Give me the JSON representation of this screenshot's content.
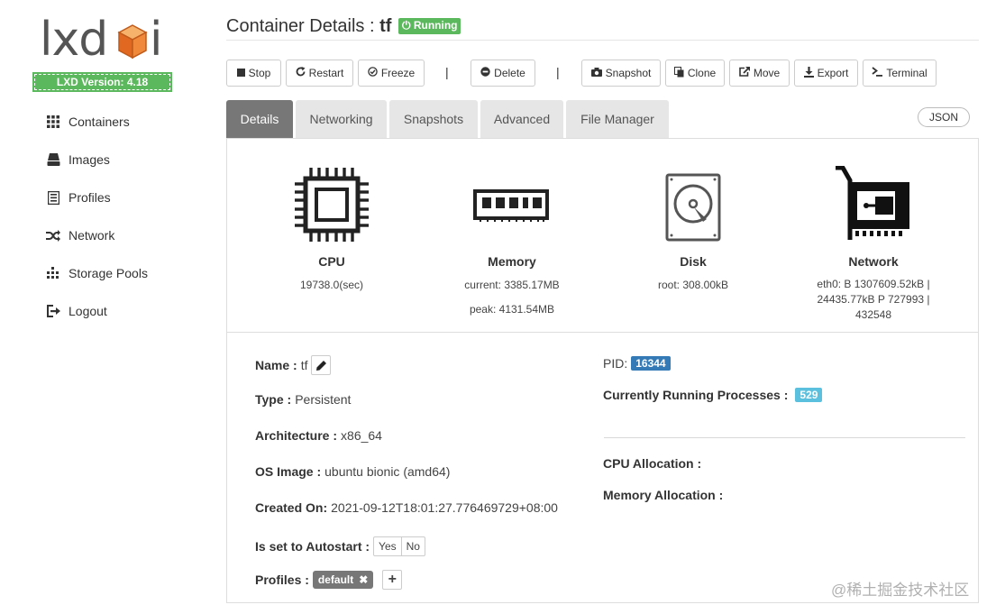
{
  "sidebar": {
    "logo_text": "lxdui",
    "version": "LXD Version: 4.18",
    "items": [
      {
        "label": "Containers",
        "icon": "grid-icon"
      },
      {
        "label": "Images",
        "icon": "hdd-icon"
      },
      {
        "label": "Profiles",
        "icon": "list-icon"
      },
      {
        "label": "Network",
        "icon": "random-icon"
      },
      {
        "label": "Storage Pools",
        "icon": "tasks-icon"
      },
      {
        "label": "Logout",
        "icon": "logout-icon"
      }
    ]
  },
  "header": {
    "title": "Container Details :",
    "container_name": "tf",
    "status": "Running"
  },
  "toolbar": {
    "stop": "Stop",
    "restart": "Restart",
    "freeze": "Freeze",
    "separator": "|",
    "delete": "Delete",
    "snapshot": "Snapshot",
    "clone": "Clone",
    "move": "Move",
    "export": "Export",
    "terminal": "Terminal"
  },
  "tabs": [
    "Details",
    "Networking",
    "Snapshots",
    "Advanced",
    "File Manager"
  ],
  "active_tab": "Details",
  "json_button": "JSON",
  "stats": {
    "cpu": {
      "label": "CPU",
      "value": "19738.0(sec)"
    },
    "memory": {
      "label": "Memory",
      "current": "current: 3385.17MB",
      "peak": "peak: 4131.54MB"
    },
    "disk": {
      "label": "Disk",
      "root": "root: 308.00kB"
    },
    "network": {
      "label": "Network",
      "line1": "eth0: B 1307609.52kB |",
      "line2": "24435.77kB P 727993 |",
      "line3": "432548"
    }
  },
  "details": {
    "name_label": "Name :",
    "name_value": "tf",
    "type_label": "Type :",
    "type_value": "Persistent",
    "arch_label": "Architecture :",
    "arch_value": "x86_64",
    "os_label": "OS Image :",
    "os_value": "ubuntu bionic (amd64)",
    "created_label": "Created On:",
    "created_value": "2021-09-12T18:01:27.776469729+08:00",
    "autostart_label": "Is set to Autostart :",
    "autostart_yes": "Yes",
    "autostart_no": "No",
    "profiles_label": "Profiles :",
    "profiles": [
      "default"
    ],
    "pid_label": "PID:",
    "pid_value": "16344",
    "processes_label": "Currently Running Processes :",
    "processes_value": "529",
    "cpu_alloc_label": "CPU Allocation :",
    "mem_alloc_label": "Memory Allocation :"
  },
  "colors": {
    "success": "#5cb85c",
    "primary": "#337ab7",
    "info": "#5bc0de",
    "tab_active": "#777777",
    "tab_inactive": "#e6e6e6"
  },
  "watermark": "@稀土掘金技术社区"
}
